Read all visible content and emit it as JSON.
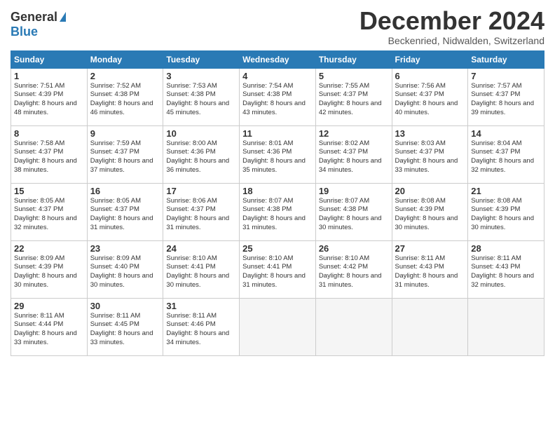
{
  "logo": {
    "general": "General",
    "blue": "Blue"
  },
  "title": {
    "month": "December 2024",
    "location": "Beckenried, Nidwalden, Switzerland"
  },
  "headers": [
    "Sunday",
    "Monday",
    "Tuesday",
    "Wednesday",
    "Thursday",
    "Friday",
    "Saturday"
  ],
  "weeks": [
    [
      {
        "day": "1",
        "sunrise": "Sunrise: 7:51 AM",
        "sunset": "Sunset: 4:39 PM",
        "daylight": "Daylight: 8 hours and 48 minutes."
      },
      {
        "day": "2",
        "sunrise": "Sunrise: 7:52 AM",
        "sunset": "Sunset: 4:38 PM",
        "daylight": "Daylight: 8 hours and 46 minutes."
      },
      {
        "day": "3",
        "sunrise": "Sunrise: 7:53 AM",
        "sunset": "Sunset: 4:38 PM",
        "daylight": "Daylight: 8 hours and 45 minutes."
      },
      {
        "day": "4",
        "sunrise": "Sunrise: 7:54 AM",
        "sunset": "Sunset: 4:38 PM",
        "daylight": "Daylight: 8 hours and 43 minutes."
      },
      {
        "day": "5",
        "sunrise": "Sunrise: 7:55 AM",
        "sunset": "Sunset: 4:37 PM",
        "daylight": "Daylight: 8 hours and 42 minutes."
      },
      {
        "day": "6",
        "sunrise": "Sunrise: 7:56 AM",
        "sunset": "Sunset: 4:37 PM",
        "daylight": "Daylight: 8 hours and 40 minutes."
      },
      {
        "day": "7",
        "sunrise": "Sunrise: 7:57 AM",
        "sunset": "Sunset: 4:37 PM",
        "daylight": "Daylight: 8 hours and 39 minutes."
      }
    ],
    [
      {
        "day": "8",
        "sunrise": "Sunrise: 7:58 AM",
        "sunset": "Sunset: 4:37 PM",
        "daylight": "Daylight: 8 hours and 38 minutes."
      },
      {
        "day": "9",
        "sunrise": "Sunrise: 7:59 AM",
        "sunset": "Sunset: 4:37 PM",
        "daylight": "Daylight: 8 hours and 37 minutes."
      },
      {
        "day": "10",
        "sunrise": "Sunrise: 8:00 AM",
        "sunset": "Sunset: 4:36 PM",
        "daylight": "Daylight: 8 hours and 36 minutes."
      },
      {
        "day": "11",
        "sunrise": "Sunrise: 8:01 AM",
        "sunset": "Sunset: 4:36 PM",
        "daylight": "Daylight: 8 hours and 35 minutes."
      },
      {
        "day": "12",
        "sunrise": "Sunrise: 8:02 AM",
        "sunset": "Sunset: 4:37 PM",
        "daylight": "Daylight: 8 hours and 34 minutes."
      },
      {
        "day": "13",
        "sunrise": "Sunrise: 8:03 AM",
        "sunset": "Sunset: 4:37 PM",
        "daylight": "Daylight: 8 hours and 33 minutes."
      },
      {
        "day": "14",
        "sunrise": "Sunrise: 8:04 AM",
        "sunset": "Sunset: 4:37 PM",
        "daylight": "Daylight: 8 hours and 32 minutes."
      }
    ],
    [
      {
        "day": "15",
        "sunrise": "Sunrise: 8:05 AM",
        "sunset": "Sunset: 4:37 PM",
        "daylight": "Daylight: 8 hours and 32 minutes."
      },
      {
        "day": "16",
        "sunrise": "Sunrise: 8:05 AM",
        "sunset": "Sunset: 4:37 PM",
        "daylight": "Daylight: 8 hours and 31 minutes."
      },
      {
        "day": "17",
        "sunrise": "Sunrise: 8:06 AM",
        "sunset": "Sunset: 4:37 PM",
        "daylight": "Daylight: 8 hours and 31 minutes."
      },
      {
        "day": "18",
        "sunrise": "Sunrise: 8:07 AM",
        "sunset": "Sunset: 4:38 PM",
        "daylight": "Daylight: 8 hours and 31 minutes."
      },
      {
        "day": "19",
        "sunrise": "Sunrise: 8:07 AM",
        "sunset": "Sunset: 4:38 PM",
        "daylight": "Daylight: 8 hours and 30 minutes."
      },
      {
        "day": "20",
        "sunrise": "Sunrise: 8:08 AM",
        "sunset": "Sunset: 4:39 PM",
        "daylight": "Daylight: 8 hours and 30 minutes."
      },
      {
        "day": "21",
        "sunrise": "Sunrise: 8:08 AM",
        "sunset": "Sunset: 4:39 PM",
        "daylight": "Daylight: 8 hours and 30 minutes."
      }
    ],
    [
      {
        "day": "22",
        "sunrise": "Sunrise: 8:09 AM",
        "sunset": "Sunset: 4:39 PM",
        "daylight": "Daylight: 8 hours and 30 minutes."
      },
      {
        "day": "23",
        "sunrise": "Sunrise: 8:09 AM",
        "sunset": "Sunset: 4:40 PM",
        "daylight": "Daylight: 8 hours and 30 minutes."
      },
      {
        "day": "24",
        "sunrise": "Sunrise: 8:10 AM",
        "sunset": "Sunset: 4:41 PM",
        "daylight": "Daylight: 8 hours and 30 minutes."
      },
      {
        "day": "25",
        "sunrise": "Sunrise: 8:10 AM",
        "sunset": "Sunset: 4:41 PM",
        "daylight": "Daylight: 8 hours and 31 minutes."
      },
      {
        "day": "26",
        "sunrise": "Sunrise: 8:10 AM",
        "sunset": "Sunset: 4:42 PM",
        "daylight": "Daylight: 8 hours and 31 minutes."
      },
      {
        "day": "27",
        "sunrise": "Sunrise: 8:11 AM",
        "sunset": "Sunset: 4:43 PM",
        "daylight": "Daylight: 8 hours and 31 minutes."
      },
      {
        "day": "28",
        "sunrise": "Sunrise: 8:11 AM",
        "sunset": "Sunset: 4:43 PM",
        "daylight": "Daylight: 8 hours and 32 minutes."
      }
    ],
    [
      {
        "day": "29",
        "sunrise": "Sunrise: 8:11 AM",
        "sunset": "Sunset: 4:44 PM",
        "daylight": "Daylight: 8 hours and 33 minutes."
      },
      {
        "day": "30",
        "sunrise": "Sunrise: 8:11 AM",
        "sunset": "Sunset: 4:45 PM",
        "daylight": "Daylight: 8 hours and 33 minutes."
      },
      {
        "day": "31",
        "sunrise": "Sunrise: 8:11 AM",
        "sunset": "Sunset: 4:46 PM",
        "daylight": "Daylight: 8 hours and 34 minutes."
      },
      null,
      null,
      null,
      null
    ]
  ]
}
